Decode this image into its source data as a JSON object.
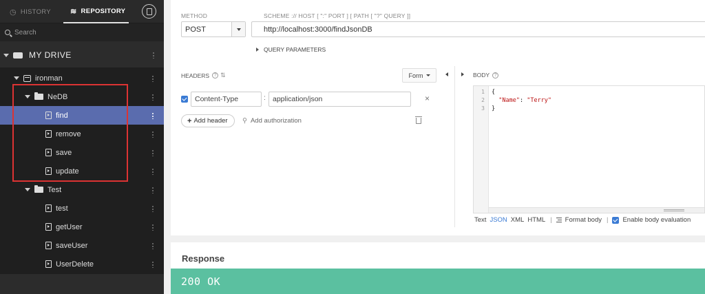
{
  "sidebar": {
    "tabs": {
      "history": "HISTORY",
      "repository": "REPOSITORY"
    },
    "search_placeholder": "Search",
    "drive_label": "MY DRIVE",
    "tree": [
      {
        "label": "ironman",
        "type": "repo",
        "selected": false
      },
      {
        "label": "NeDB",
        "type": "folder",
        "selected": false
      },
      {
        "label": "find",
        "type": "request",
        "selected": true
      },
      {
        "label": "remove",
        "type": "request",
        "selected": false
      },
      {
        "label": "save",
        "type": "request",
        "selected": false
      },
      {
        "label": "update",
        "type": "request",
        "selected": false
      },
      {
        "label": "Test",
        "type": "folder",
        "selected": false
      },
      {
        "label": "test",
        "type": "request",
        "selected": false
      },
      {
        "label": "getUser",
        "type": "request",
        "selected": false
      },
      {
        "label": "saveUser",
        "type": "request",
        "selected": false
      },
      {
        "label": "UserDelete",
        "type": "request",
        "selected": false
      }
    ]
  },
  "request": {
    "method_label": "METHOD",
    "method": "POST",
    "scheme_label": "SCHEME :// HOST [ \":\" PORT ] [ PATH [ \"?\" QUERY ]]",
    "url": "http://localhost:3000/findJsonDB",
    "query_params": "QUERY PARAMETERS"
  },
  "headers": {
    "label": "HEADERS",
    "form_mode": "Form",
    "rows": [
      {
        "name": "Content-Type",
        "value": "application/json",
        "enabled": true
      }
    ],
    "add_header": "Add header",
    "add_auth": "Add authorization"
  },
  "body": {
    "label": "BODY",
    "line_numbers": [
      "1",
      "2",
      "3"
    ],
    "code": {
      "open": "{",
      "key": "\"Name\"",
      "sep": ": ",
      "value": "\"Terry\"",
      "close": "}"
    },
    "formats": {
      "text": "Text",
      "json": "JSON",
      "xml": "XML",
      "html": "HTML",
      "active": "JSON"
    },
    "format_body": "Format body",
    "enable_eval": "Enable body evaluation"
  },
  "response": {
    "title": "Response",
    "status": "200 OK",
    "status_color": "#5bc0a0"
  },
  "colors": {
    "accent": "#3b7bd4",
    "selection": "#5a6cae",
    "highlight_box": "#dd3333"
  }
}
